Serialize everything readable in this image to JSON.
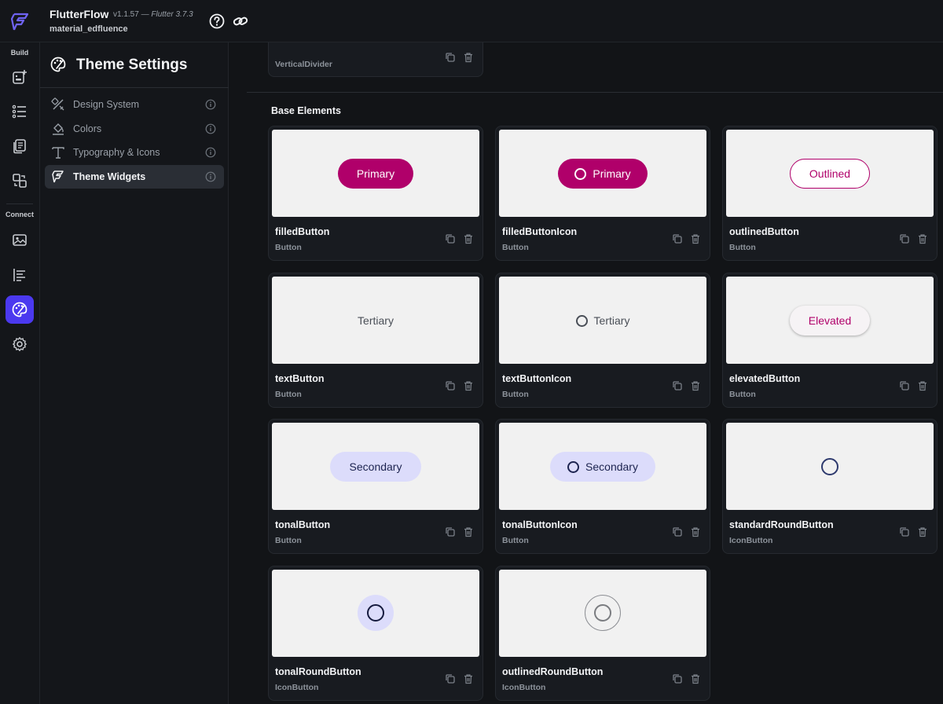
{
  "header": {
    "app_name": "FlutterFlow",
    "version": "v1.1.57",
    "flutter_version": "— Flutter 3.7.3",
    "project": "material_edfluence",
    "help_icon": "help-circle-icon",
    "link_icon": "link-icon"
  },
  "rail": {
    "build_label": "Build",
    "connect_label": "Connect",
    "items": [
      {
        "icon": "add-widget-icon"
      },
      {
        "icon": "widget-tree-icon"
      },
      {
        "icon": "pages-icon"
      },
      {
        "icon": "components-icon"
      },
      {
        "icon": "media-assets-icon"
      },
      {
        "icon": "api-calls-icon"
      },
      {
        "icon": "theme-palette-icon",
        "active": true
      },
      {
        "icon": "settings-gear-icon"
      }
    ]
  },
  "panel": {
    "title": "Theme Settings",
    "items": [
      {
        "label": "Design System",
        "icon": "design-tools-icon"
      },
      {
        "label": "Colors",
        "icon": "paint-bucket-icon"
      },
      {
        "label": "Typography & Icons",
        "icon": "typography-icon"
      },
      {
        "label": "Theme Widgets",
        "icon": "flutterflow-icon",
        "active": true
      }
    ]
  },
  "main": {
    "previous_card": {
      "name": "VerticalDivider"
    },
    "section_title": "Base Elements",
    "cards": [
      {
        "name": "filledButton",
        "type": "Button",
        "preview_text": "Primary"
      },
      {
        "name": "filledButtonIcon",
        "type": "Button",
        "preview_text": "Primary"
      },
      {
        "name": "outlinedButton",
        "type": "Button",
        "preview_text": "Outlined"
      },
      {
        "name": "textButton",
        "type": "Button",
        "preview_text": "Tertiary"
      },
      {
        "name": "textButtonIcon",
        "type": "Button",
        "preview_text": "Tertiary"
      },
      {
        "name": "elevatedButton",
        "type": "Button",
        "preview_text": "Elevated"
      },
      {
        "name": "tonalButton",
        "type": "Button",
        "preview_text": "Secondary"
      },
      {
        "name": "tonalButtonIcon",
        "type": "Button",
        "preview_text": "Secondary"
      },
      {
        "name": "standardRoundButton",
        "type": "IconButton"
      },
      {
        "name": "tonalRoundButton",
        "type": "IconButton"
      },
      {
        "name": "outlinedRoundButton",
        "type": "IconButton"
      }
    ]
  },
  "colors": {
    "primary": "#b0006a",
    "secondary_container": "#dcdcfb",
    "accent": "#4b39ef",
    "icon_dark": "#2e3a6e"
  }
}
